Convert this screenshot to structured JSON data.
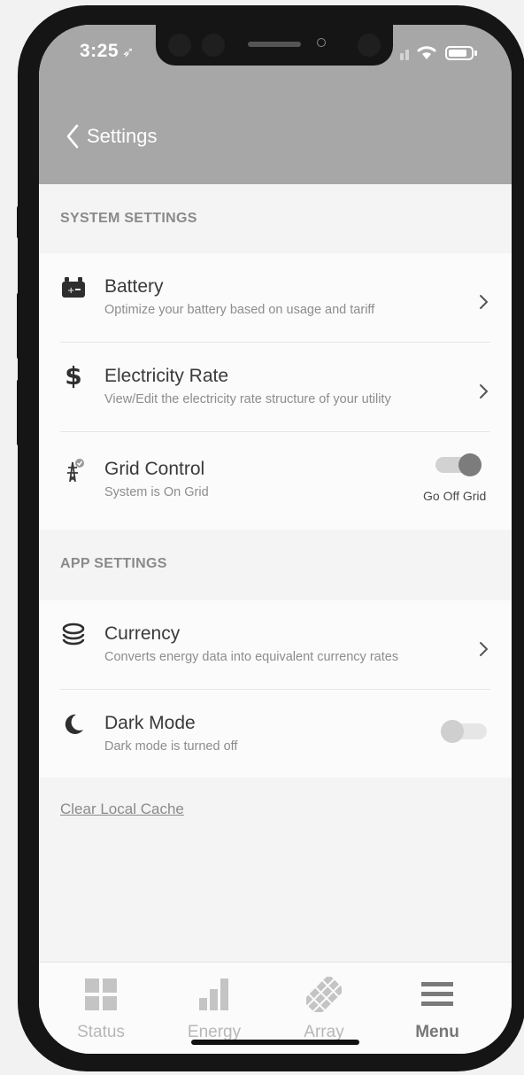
{
  "status_bar": {
    "time": "3:25"
  },
  "nav": {
    "back_label": "Settings"
  },
  "system_settings": {
    "heading": "SYSTEM SETTINGS",
    "items": [
      {
        "title": "Battery",
        "subtitle": "Optimize your battery based on usage and tariff",
        "icon": "battery-icon"
      },
      {
        "title": "Electricity Rate",
        "subtitle": "View/Edit the electricity rate structure of your utility",
        "icon": "dollar-icon"
      },
      {
        "title": "Grid Control",
        "subtitle": "System is On Grid",
        "icon": "power-tower-icon",
        "toggle_label": "Go Off Grid",
        "toggle_on": true
      }
    ]
  },
  "app_settings": {
    "heading": "APP SETTINGS",
    "items": [
      {
        "title": "Currency",
        "subtitle": "Converts energy data into equivalent currency rates",
        "icon": "coins-icon"
      },
      {
        "title": "Dark Mode",
        "subtitle": "Dark mode is turned off",
        "icon": "moon-icon",
        "toggle_on": false
      }
    ]
  },
  "clear_cache_label": "Clear Local Cache",
  "tabs": [
    {
      "label": "Status",
      "icon": "grid-icon",
      "active": false
    },
    {
      "label": "Energy",
      "icon": "bar-chart-icon",
      "active": false
    },
    {
      "label": "Array",
      "icon": "solar-array-icon",
      "active": false
    },
    {
      "label": "Menu",
      "icon": "menu-icon",
      "active": true
    }
  ],
  "colors": {
    "header": "#a7a7a7",
    "background": "#f4f4f4",
    "card": "#fbfbfb",
    "toggle_on_knob": "#7c7c7c",
    "toggle_off_knob": "#cfcfcf"
  }
}
